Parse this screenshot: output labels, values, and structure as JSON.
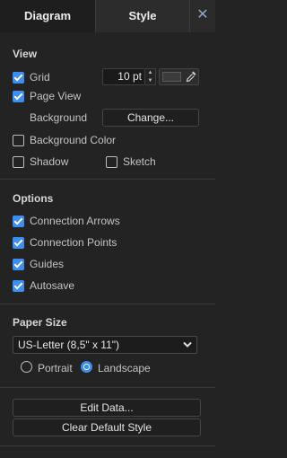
{
  "tabs": {
    "diagram": "Diagram",
    "style": "Style",
    "close": "✕"
  },
  "view": {
    "title": "View",
    "grid_label": "Grid",
    "grid_size": "10 pt",
    "page_view_label": "Page View",
    "background_label": "Background",
    "change_button": "Change...",
    "background_color_label": "Background Color",
    "shadow_label": "Shadow",
    "sketch_label": "Sketch"
  },
  "options": {
    "title": "Options",
    "connection_arrows": "Connection Arrows",
    "connection_points": "Connection Points",
    "guides": "Guides",
    "autosave": "Autosave"
  },
  "paper": {
    "title": "Paper Size",
    "selected": "US-Letter (8,5\" x 11\")",
    "portrait": "Portrait",
    "landscape": "Landscape"
  },
  "actions": {
    "edit_data": "Edit Data...",
    "clear_default_style": "Clear Default Style"
  },
  "colors": {
    "accent": "#3c8ff0",
    "background": "#232323",
    "close_icon": "#8fa6c9"
  }
}
